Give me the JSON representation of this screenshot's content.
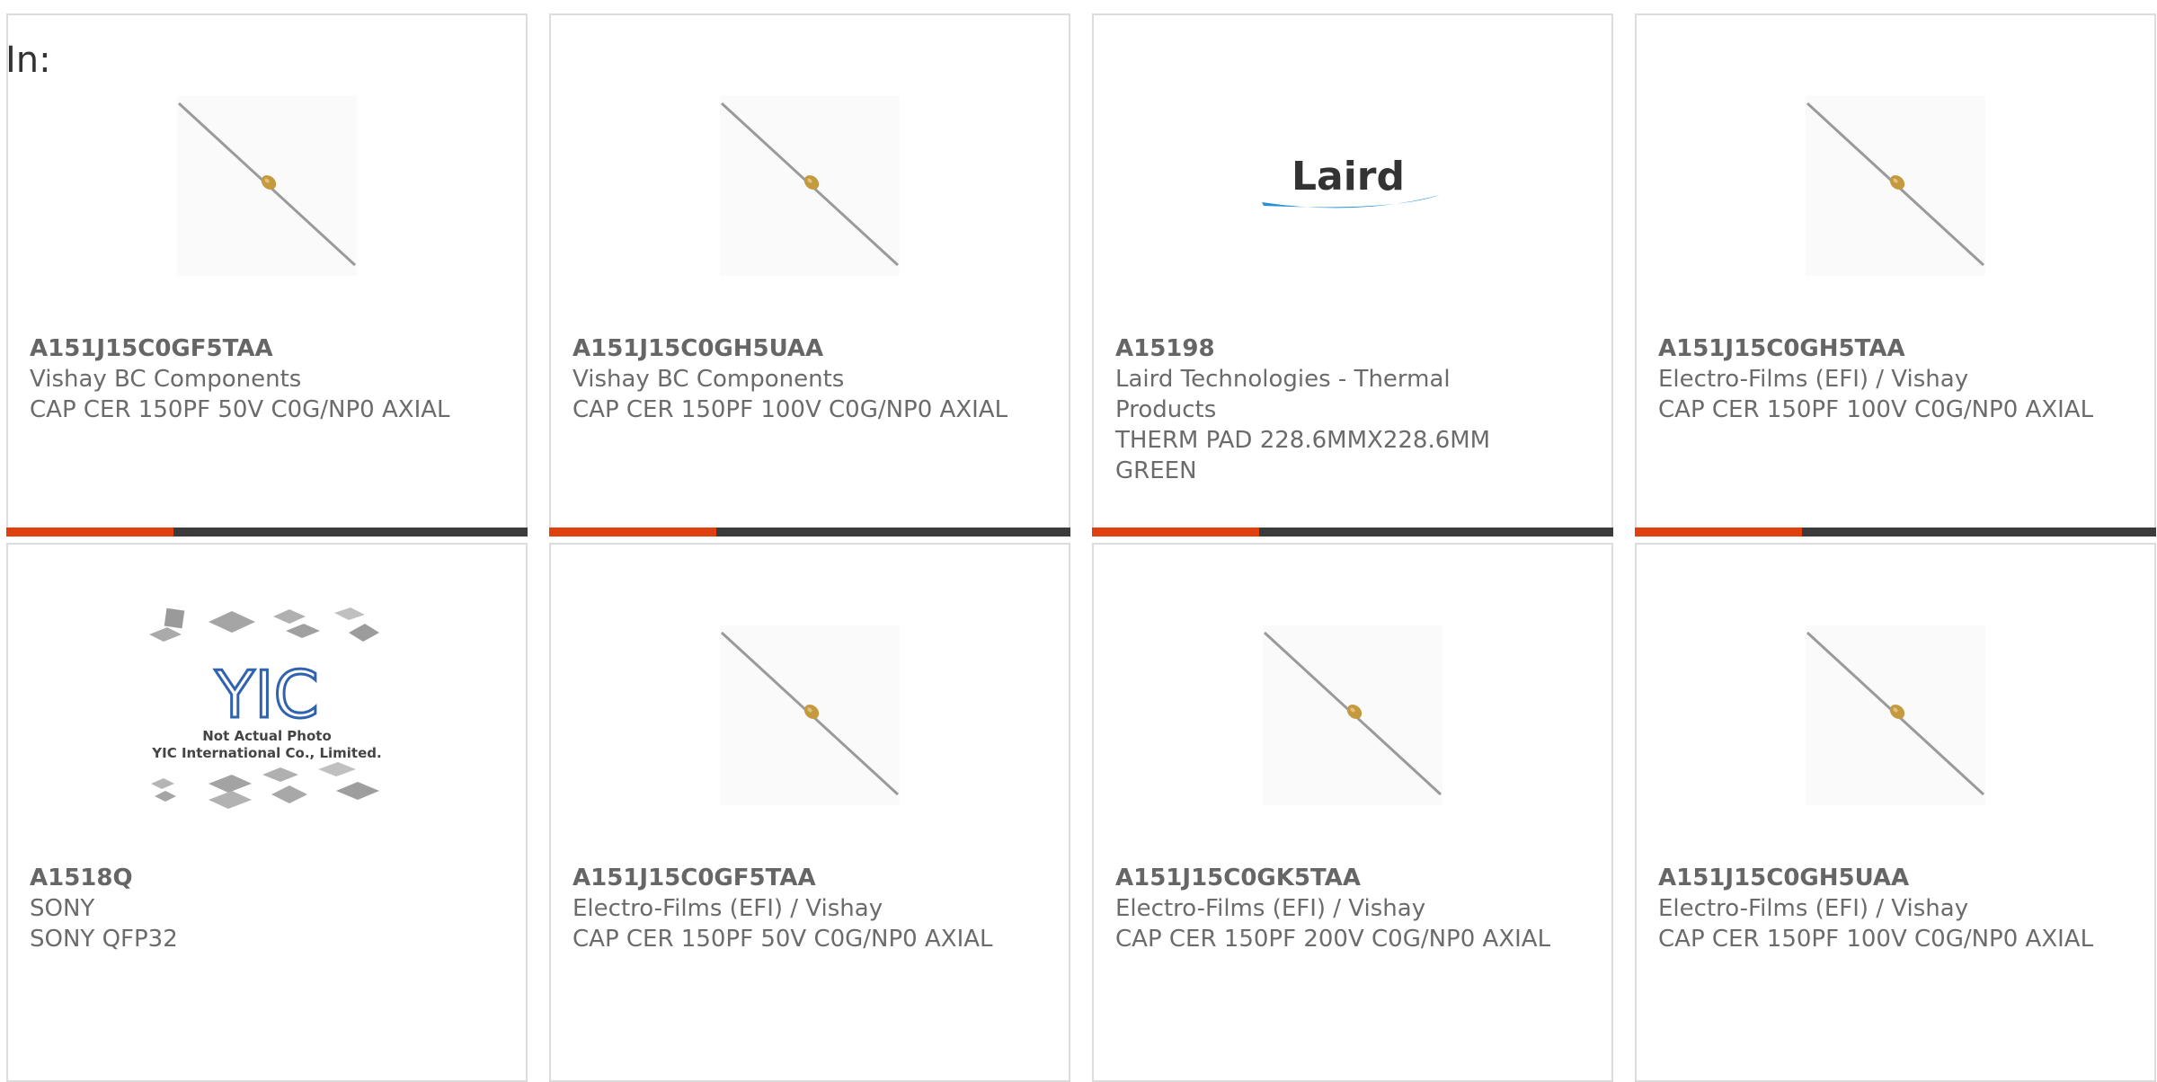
{
  "filter_label": "In:",
  "colors": {
    "accent": "#e0400e",
    "bar_track": "#3b3b3b",
    "text": "#6b6b6b",
    "border": "#dcdcdc"
  },
  "products": [
    {
      "part_number": "A151J15C0GF5TAA",
      "manufacturer": "Vishay BC Components",
      "description": "CAP CER 150PF 50V C0G/NP0 AXIAL",
      "image": "axial-capacitor-image",
      "progress": 0.32
    },
    {
      "part_number": "A151J15C0GH5UAA",
      "manufacturer": "Vishay BC Components",
      "description": "CAP CER 150PF 100V C0G/NP0 AXIAL",
      "image": "axial-capacitor-image",
      "progress": 0.32
    },
    {
      "part_number": "A15198",
      "manufacturer": "Laird Technologies - Thermal Products",
      "description": "THERM PAD 228.6MMX228.6MM GREEN",
      "image": "laird-logo",
      "logo_text": "Laird",
      "progress": 0.32
    },
    {
      "part_number": "A151J15C0GH5TAA",
      "manufacturer": "Electro-Films (EFI) / Vishay",
      "description": "CAP CER 150PF 100V C0G/NP0 AXIAL",
      "image": "axial-capacitor-image",
      "progress": 0.32
    },
    {
      "part_number": "A1518Q",
      "manufacturer": "SONY",
      "description": "SONY QFP32",
      "image": "yic-placeholder-image",
      "logo_text": "YIC",
      "placeholder_line1": "Not Actual Photo",
      "placeholder_line2": "YIC International Co., Limited."
    },
    {
      "part_number": "A151J15C0GF5TAA",
      "manufacturer": "Electro-Films (EFI) / Vishay",
      "description": "CAP CER 150PF 50V C0G/NP0 AXIAL",
      "image": "axial-capacitor-image"
    },
    {
      "part_number": "A151J15C0GK5TAA",
      "manufacturer": "Electro-Films (EFI) / Vishay",
      "description": "CAP CER 150PF 200V C0G/NP0 AXIAL",
      "image": "axial-capacitor-image"
    },
    {
      "part_number": "A151J15C0GH5UAA",
      "manufacturer": "Electro-Films (EFI) / Vishay",
      "description": "CAP CER 150PF 100V C0G/NP0 AXIAL",
      "image": "axial-capacitor-image"
    }
  ]
}
